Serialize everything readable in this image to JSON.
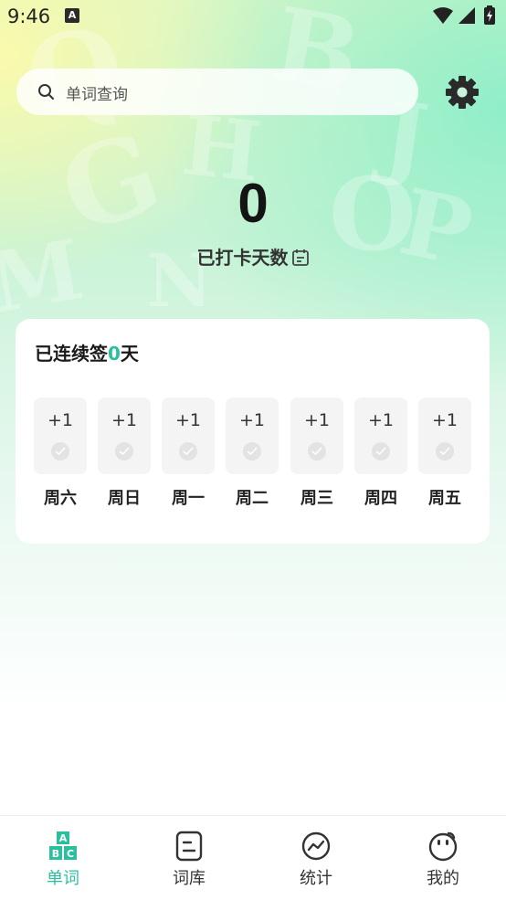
{
  "status_bar": {
    "time": "9:46",
    "notification_icon": "a-notification-icon",
    "icons": [
      "wifi-icon",
      "signal-icon",
      "battery-charging-icon"
    ]
  },
  "search": {
    "placeholder": "单词查询",
    "icon": "search-icon"
  },
  "settings": {
    "icon": "gear-icon"
  },
  "checkin": {
    "days_count": "0",
    "days_label": "已打卡天数",
    "label_icon": "calendar-icon"
  },
  "sign_card": {
    "title_prefix": "已连续签",
    "streak": "0",
    "title_suffix": "天",
    "days": [
      {
        "reward": "+1",
        "name": "周六"
      },
      {
        "reward": "+1",
        "name": "周日"
      },
      {
        "reward": "+1",
        "name": "周一"
      },
      {
        "reward": "+1",
        "name": "周二"
      },
      {
        "reward": "+1",
        "name": "周三"
      },
      {
        "reward": "+1",
        "name": "周四"
      },
      {
        "reward": "+1",
        "name": "周五"
      }
    ]
  },
  "bottom_nav": {
    "items": [
      {
        "label": "单词",
        "icon": "abc-blocks-icon",
        "active": true
      },
      {
        "label": "词库",
        "icon": "book-icon",
        "active": false
      },
      {
        "label": "统计",
        "icon": "chart-trend-icon",
        "active": false
      },
      {
        "label": "我的",
        "icon": "face-icon",
        "active": false
      }
    ]
  },
  "colors": {
    "accent": "#2bbf9f",
    "text": "#1a1a1a"
  }
}
